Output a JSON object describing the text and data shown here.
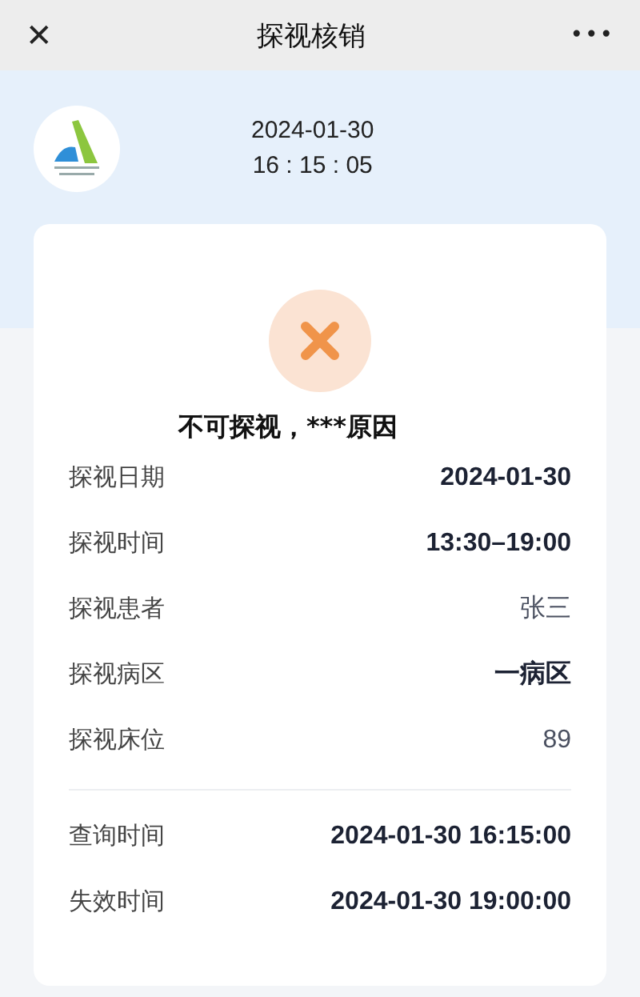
{
  "window": {
    "close": "✕",
    "title": "探视核销",
    "more": "•••"
  },
  "header": {
    "date": "2024-01-30",
    "time": "16 : 15 : 05"
  },
  "result": {
    "message": "不可探视，***原因"
  },
  "details": [
    {
      "label": "探视日期",
      "value": "2024-01-30",
      "emphasis": true
    },
    {
      "label": "探视时间",
      "value": "13:30–19:00",
      "emphasis": true
    },
    {
      "label": "探视患者",
      "value": "张三",
      "emphasis": false
    },
    {
      "label": "探视病区",
      "value": "一病区",
      "emphasis": true
    },
    {
      "label": "探视床位",
      "value": "89",
      "emphasis": false
    }
  ],
  "times": [
    {
      "label": "查询时间",
      "value": "2024-01-30 16:15:00",
      "emphasis": true
    },
    {
      "label": "失效时间",
      "value": "2024-01-30 19:00:00",
      "emphasis": true
    }
  ]
}
